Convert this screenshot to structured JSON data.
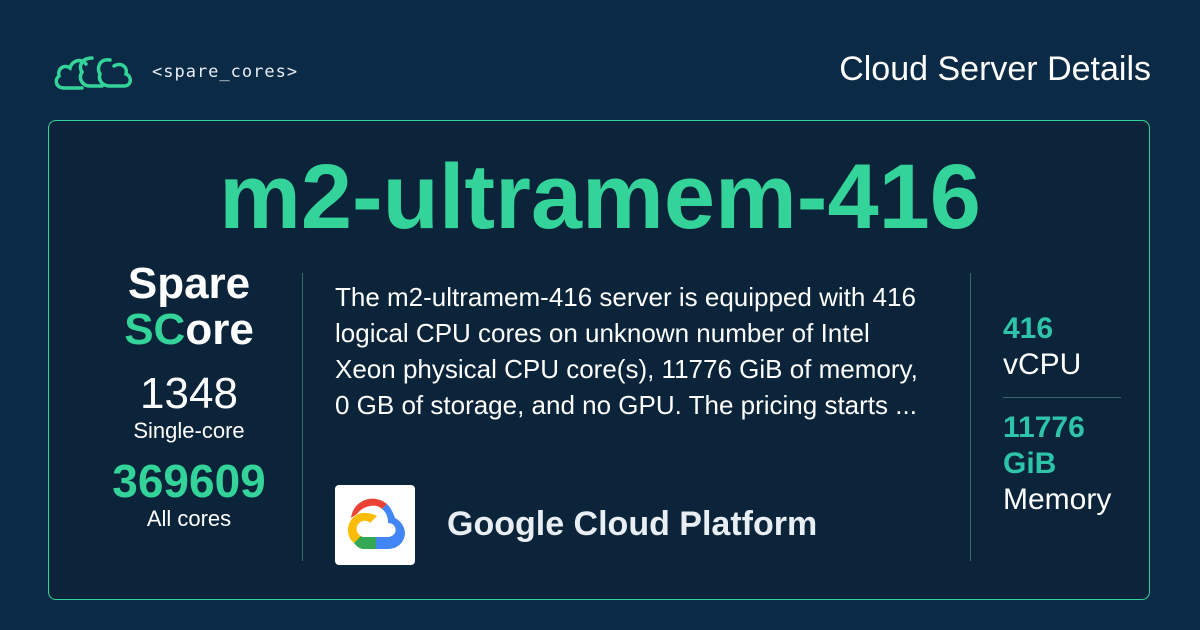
{
  "header": {
    "brand": "<spare_cores>",
    "title": "Cloud Server Details"
  },
  "server": {
    "name": "m2-ultramem-416",
    "description": "The m2-ultramem-416 server is equipped with 416 logical CPU cores on unknown number of Intel Xeon physical CPU core(s), 11776 GiB of memory, 0 GB of storage, and no GPU. The pricing starts ..."
  },
  "score": {
    "title_line1": "Spare",
    "title_accent": "SC",
    "title_rest": "ore",
    "single_value": "1348",
    "single_label": "Single-core",
    "all_value": "369609",
    "all_label": "All cores"
  },
  "vendor": {
    "name": "Google Cloud Platform",
    "logo_icon": "google-cloud-icon"
  },
  "specs": {
    "vcpu_value": "416",
    "vcpu_label": "vCPU",
    "memory_value": "11776 GiB",
    "memory_label": "Memory"
  },
  "colors": {
    "background": "#0b2a45",
    "accent": "#34d399",
    "spec_accent": "#2ec4a9"
  }
}
